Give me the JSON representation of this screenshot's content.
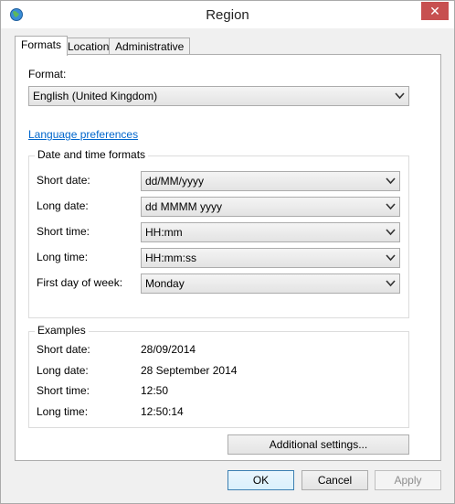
{
  "window": {
    "title": "Region"
  },
  "tabs": [
    {
      "label": "Formats"
    },
    {
      "label": "Location"
    },
    {
      "label": "Administrative"
    }
  ],
  "format": {
    "label": "Format:",
    "value": "English (United Kingdom)"
  },
  "language_link": "Language preferences",
  "datetime": {
    "title": "Date and time formats",
    "rows": [
      {
        "label": "Short date:",
        "value": "dd/MM/yyyy"
      },
      {
        "label": "Long date:",
        "value": "dd MMMM yyyy"
      },
      {
        "label": "Short time:",
        "value": "HH:mm"
      },
      {
        "label": "Long time:",
        "value": "HH:mm:ss"
      },
      {
        "label": "First day of week:",
        "value": "Monday"
      }
    ]
  },
  "examples": {
    "title": "Examples",
    "rows": [
      {
        "label": "Short date:",
        "value": "28/09/2014"
      },
      {
        "label": "Long date:",
        "value": "28 September 2014"
      },
      {
        "label": "Short time:",
        "value": "12:50"
      },
      {
        "label": "Long time:",
        "value": "12:50:14"
      }
    ]
  },
  "buttons": {
    "additional": "Additional settings...",
    "ok": "OK",
    "cancel": "Cancel",
    "apply": "Apply"
  },
  "colors": {
    "link": "#0066cc",
    "close": "#c75050"
  }
}
